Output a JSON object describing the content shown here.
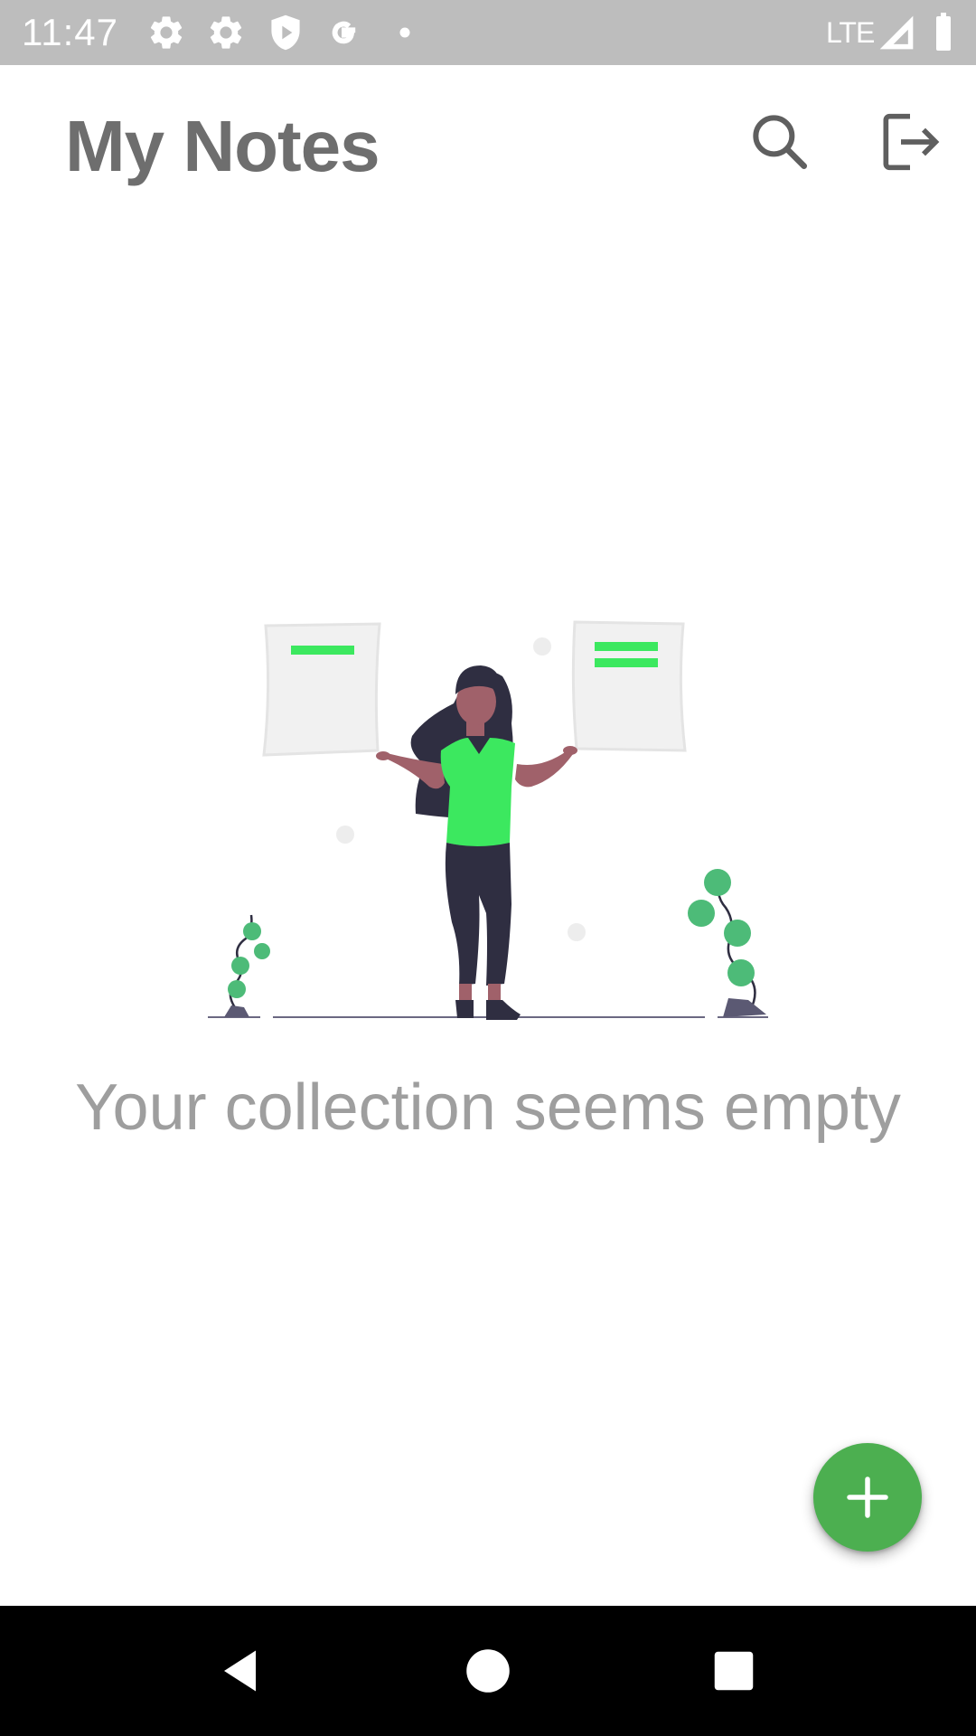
{
  "status_bar": {
    "time": "11:47",
    "network": "LTE",
    "icons": [
      "settings-icon",
      "settings-icon",
      "play-protect-icon",
      "google-icon",
      "notification-dot-icon",
      "signal-icon",
      "battery-icon"
    ]
  },
  "app_bar": {
    "title": "My Notes",
    "actions": [
      "search-icon",
      "logout-icon"
    ],
    "title_color": "#6e6e6e"
  },
  "empty_state": {
    "message": "Your collection seems empty",
    "illustration": "person-holding-notes-illustration",
    "accent_color": "#3ce85f"
  },
  "fab": {
    "icon": "plus-icon",
    "color": "#4caf50"
  },
  "nav_bar": {
    "buttons": [
      "back-icon",
      "home-icon",
      "recents-icon"
    ]
  }
}
